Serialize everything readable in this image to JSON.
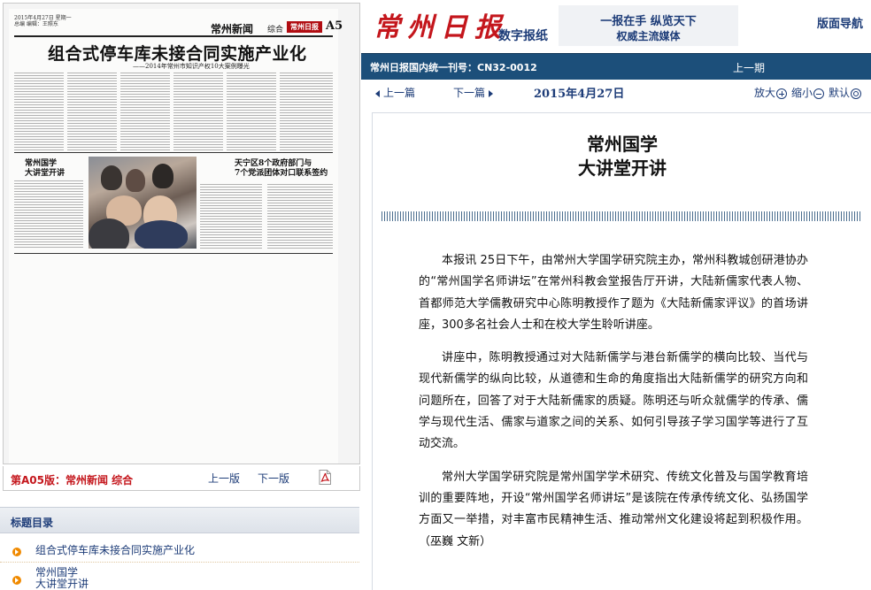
{
  "paper": {
    "date_line": "2015年4月27日 星期一",
    "date_line2": "总编 编辑：王照东",
    "section": "常州新闻",
    "section_sub": "综合",
    "logo_text": "常州日报",
    "page_no": "A5",
    "headline": "组合式停车库未接合同实施产业化",
    "subhead": "——2014年常州市知识产权10大案例曝光",
    "block_title_1": "常州国学\n大讲堂开讲",
    "block_title_2": "天宁区8个政府部门与\n7个党派团体对口联系签约"
  },
  "edition": {
    "label": "第A05版：常州新闻 综合",
    "prev": "上一版",
    "next": "下一版"
  },
  "toc": {
    "title": "标题目录",
    "items": [
      "组合式停车库未接合同实施产业化",
      "常州国学\n大讲堂开讲"
    ]
  },
  "masthead": {
    "logo": "常州日报",
    "logo_sub": "数字报纸",
    "slogan_line1": "一报在手  纵览天下",
    "slogan_line2": "权威主流媒体",
    "nav": "版面导航"
  },
  "info_bar": {
    "text": "常州日报国内统一刊号：CN32-0012",
    "prev_issue": "上一期"
  },
  "toolbar": {
    "prev": "上一篇",
    "next": "下一篇",
    "date": "2015年4月27日",
    "zoom_in": "放大",
    "zoom_out": "缩小",
    "default": "默认"
  },
  "article": {
    "title_line1": "常州国学",
    "title_line2": "大讲堂开讲",
    "paragraphs": [
      "本报讯 25日下午，由常州大学国学研究院主办，常州科教城创研港协办的“常州国学名师讲坛”在常州科教会堂报告厅开讲，大陆新儒家代表人物、首都师范大学儒教研究中心陈明教授作了题为《大陆新儒家评议》的首场讲座，300多名社会人士和在校大学生聆听讲座。",
      "讲座中，陈明教授通过对大陆新儒学与港台新儒学的横向比较、当代与现代新儒学的纵向比较，从道德和生命的角度指出大陆新儒学的研究方向和问题所在，回答了对于大陆新儒家的质疑。陈明还与听众就儒学的传承、儒学与现代生活、儒家与道家之间的关系、如何引导孩子学习国学等进行了互动交流。",
      "常州大学国学研究院是常州国学学术研究、传统文化普及与国学教育培训的重要阵地，开设“常州国学名师讲坛”是该院在传承传统文化、弘扬国学方面又一举措，对丰富市民精神生活、推动常州文化建设将起到积极作用。  （巫巍 文新）"
    ]
  },
  "colors": {
    "brand_red": "#c4161c",
    "link_blue": "#1d3c78",
    "info_bar_bg": "#1c4f7a",
    "bullet_orange": "#f08a00"
  },
  "icons": [
    "pdf-icon",
    "zoom-in-icon",
    "zoom-out-icon",
    "default-size-icon",
    "toc-bullet-icon",
    "prev-arrow-icon",
    "next-arrow-icon"
  ]
}
